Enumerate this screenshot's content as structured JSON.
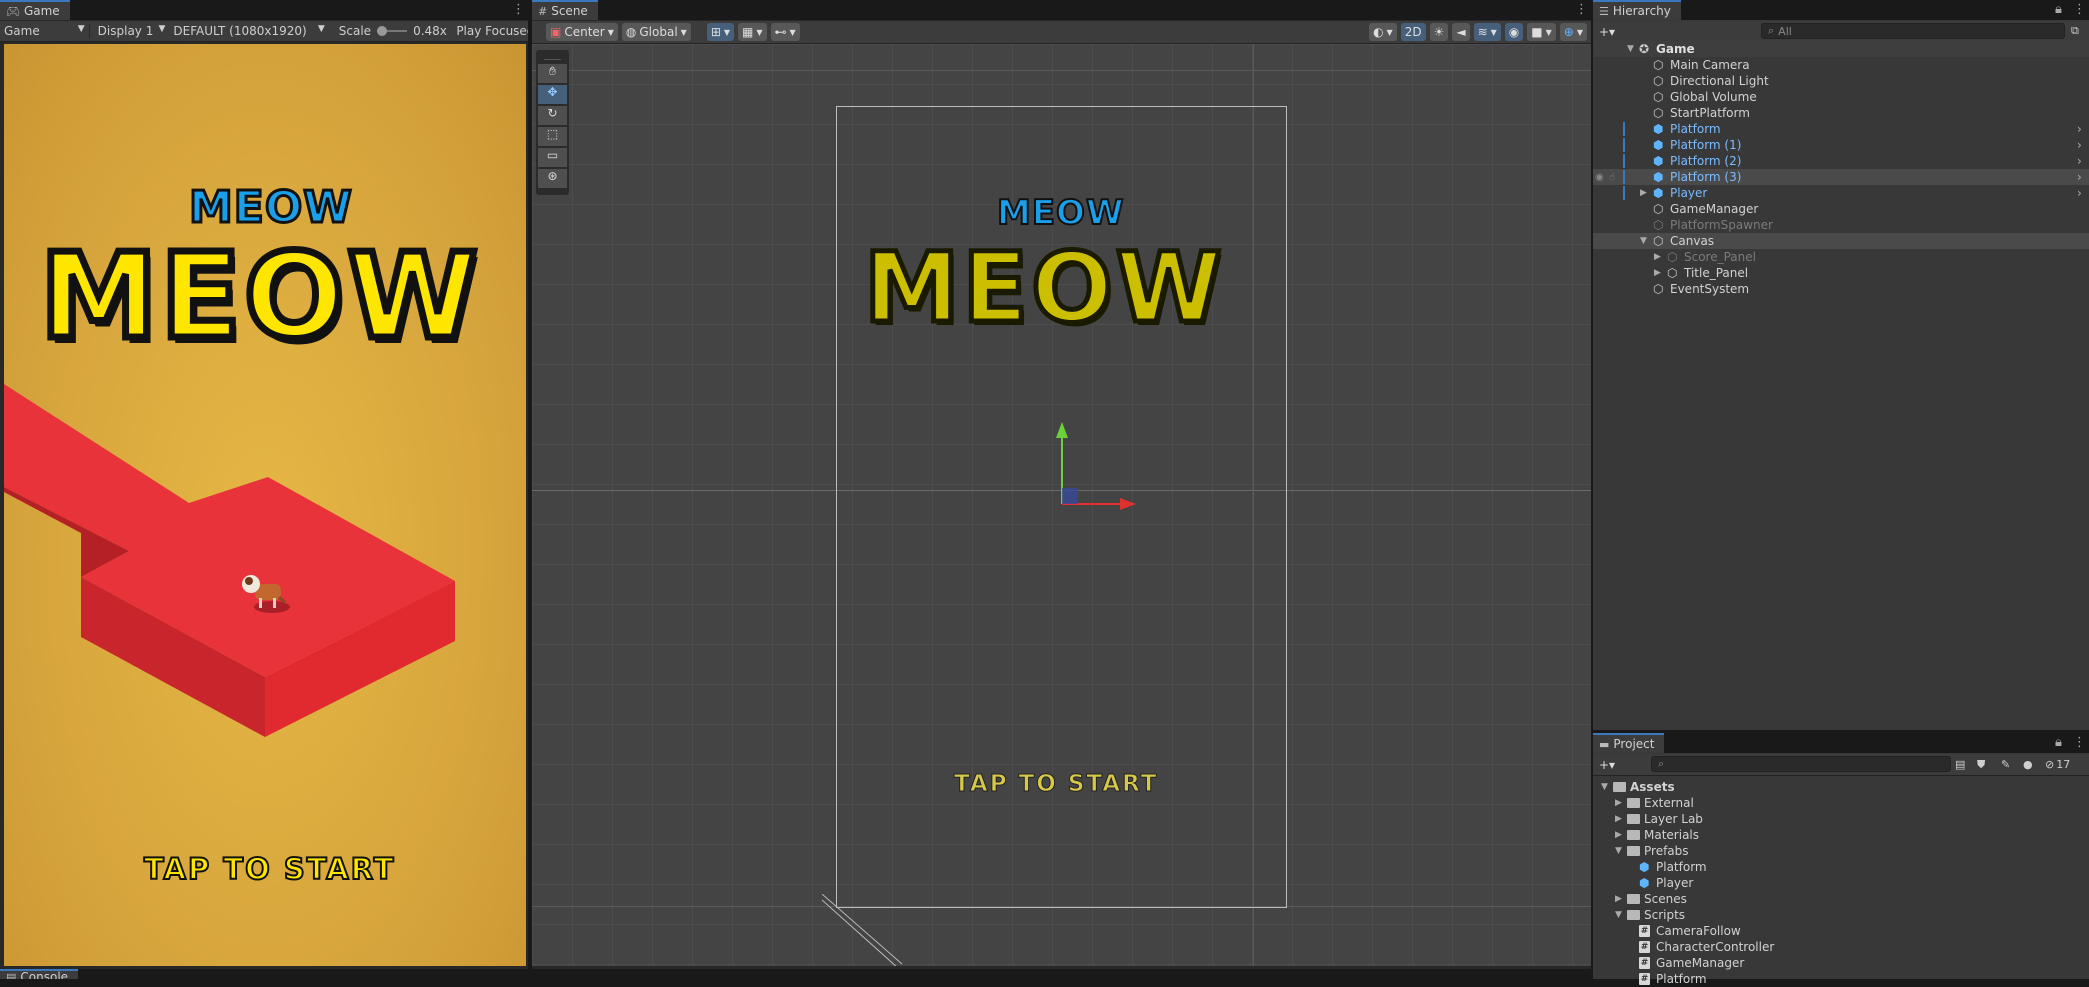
{
  "game": {
    "tab_label": "Game",
    "mode": "Game",
    "display": "Display 1",
    "resolution": "DEFAULT (1080x1920)",
    "scale_label": "Scale",
    "scale_value": "0.48x",
    "play_focused": "Play Focused",
    "title_small": "MEOW",
    "title_big": "MEOW",
    "tap_to_start": "TAP TO START"
  },
  "scene": {
    "tab_label": "Scene",
    "pivot": "Center",
    "space": "Global",
    "mode_2d": "2D",
    "title_small": "MEOW",
    "title_big": "MEOW",
    "tap_to_start": "TAP TO START"
  },
  "hierarchy": {
    "tab_label": "Hierarchy",
    "search_placeholder": "All",
    "scene_name": "Game",
    "items": [
      {
        "label": "Main Camera"
      },
      {
        "label": "Directional Light"
      },
      {
        "label": "Global Volume"
      },
      {
        "label": "StartPlatform"
      },
      {
        "label": "Platform"
      },
      {
        "label": "Platform (1)"
      },
      {
        "label": "Platform (2)"
      },
      {
        "label": "Platform (3)"
      },
      {
        "label": "Player"
      },
      {
        "label": "GameManager"
      },
      {
        "label": "PlatformSpawner"
      },
      {
        "label": "Canvas"
      },
      {
        "label": "Score_Panel"
      },
      {
        "label": "Title_Panel"
      },
      {
        "label": "EventSystem"
      }
    ]
  },
  "project": {
    "tab_label": "Project",
    "hidden_count": "17",
    "items": [
      {
        "label": "Assets"
      },
      {
        "label": "External"
      },
      {
        "label": "Layer Lab"
      },
      {
        "label": "Materials"
      },
      {
        "label": "Prefabs"
      },
      {
        "label": "Platform"
      },
      {
        "label": "Player"
      },
      {
        "label": "Scenes"
      },
      {
        "label": "Scripts"
      },
      {
        "label": "CameraFollow"
      },
      {
        "label": "CharacterController"
      },
      {
        "label": "GameManager"
      },
      {
        "label": "Platform"
      }
    ]
  },
  "console": {
    "tab_label": "Console"
  },
  "colors": {
    "accent": "#3a79bb",
    "game_bg": "#d4a23b",
    "platform_red": "#e8333a",
    "title_yellow": "#ffe600",
    "title_blue": "#1aa0ea",
    "prefab_blue": "#7cbcff"
  }
}
